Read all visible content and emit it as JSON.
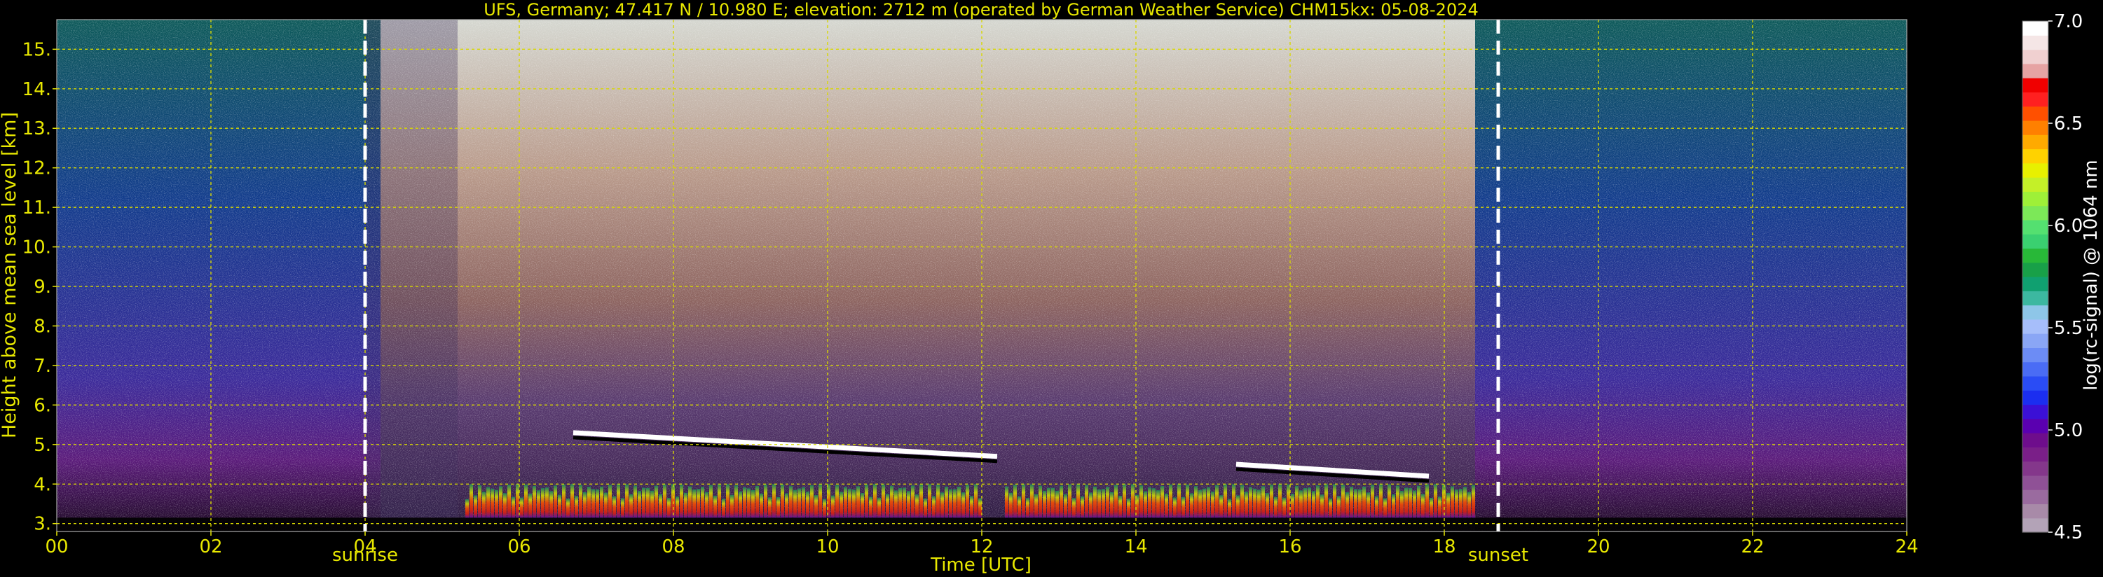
{
  "chart_data": {
    "type": "heatmap",
    "title": "UFS, Germany; 47.417 N / 10.980 E; elevation: 2712 m  (operated by German Weather Service)    CHM15kx: 05-08-2024",
    "xlabel": "Time [UTC]",
    "ylabel": "Height above mean sea level [km]",
    "xlim": [
      0,
      24
    ],
    "ylim": [
      2.8,
      15.75
    ],
    "x_ticks": [
      0,
      2,
      4,
      6,
      8,
      10,
      12,
      14,
      16,
      18,
      20,
      22,
      24
    ],
    "x_tick_labels": [
      "00",
      "02",
      "04",
      "06",
      "08",
      "10",
      "12",
      "14",
      "16",
      "18",
      "20",
      "22",
      "24"
    ],
    "y_ticks": [
      3,
      4,
      5,
      6,
      7,
      8,
      9,
      10,
      11,
      12,
      13,
      14,
      15
    ],
    "y_tick_labels": [
      "3.",
      "4.",
      "5.",
      "6.",
      "7.",
      "8.",
      "9.",
      "10.",
      "11.",
      "12.",
      "13.",
      "14.",
      "15."
    ],
    "grid": true,
    "grid_color": "#d8d800",
    "text_color": "#e8e800",
    "annotations": [
      {
        "label": "sunrise",
        "x": 4.0
      },
      {
        "label": "sunset",
        "x": 18.7
      }
    ],
    "colorbar": {
      "label": "log(rc-signal) @ 1064 nm",
      "range": [
        4.5,
        7.0
      ],
      "tick_values": [
        4.5,
        5.0,
        5.5,
        6.0,
        6.5,
        7.0
      ],
      "tick_labels": [
        "4.5",
        "5.0",
        "5.5",
        "6.0",
        "6.5",
        "7.0"
      ],
      "colors": [
        "#b3a3b7",
        "#a88aa8",
        "#9a6b9f",
        "#8f5196",
        "#84378b",
        "#7a1f88",
        "#6e0d8c",
        "#5a00b0",
        "#3b10d6",
        "#1b2ef0",
        "#2a4cf5",
        "#4a6cf5",
        "#6c8cf5",
        "#8aa6f5",
        "#a6befa",
        "#8ec6e8",
        "#3cb8a0",
        "#10a070",
        "#18a048",
        "#28b838",
        "#3ad070",
        "#54e070",
        "#7ce858",
        "#9ef038",
        "#c4f028",
        "#e8f000",
        "#ffd200",
        "#ffaa00",
        "#ff8000",
        "#ff5000",
        "#ff2020",
        "#f00000",
        "#e6a3a3",
        "#f0d0d0",
        "#f5e6e6",
        "#ffffff"
      ]
    },
    "features": {
      "cloud_layers_km": [
        {
          "start": 6.7,
          "end": 12.2,
          "height_start": 5.3,
          "height_end": 4.7
        },
        {
          "start": 15.3,
          "end": 17.8,
          "height_start": 4.5,
          "height_end": 4.2
        }
      ],
      "strong_boundary_layer_km": [
        {
          "start": 5.3,
          "end": 12.0,
          "top": 4.0
        },
        {
          "start": 12.3,
          "end": 18.4,
          "top": 4.0
        }
      ]
    }
  }
}
